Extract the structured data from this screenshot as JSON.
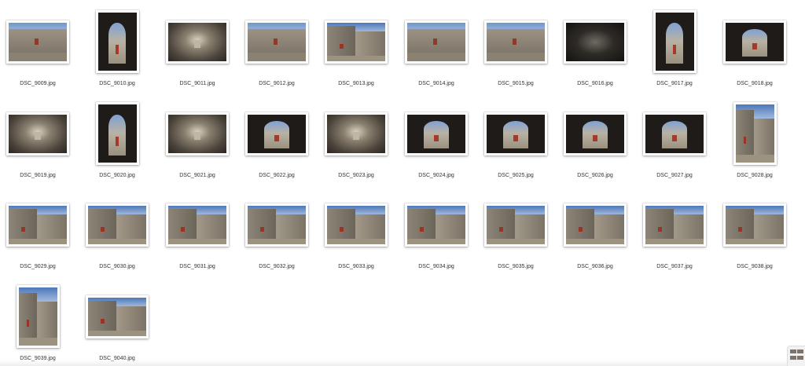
{
  "files": [
    {
      "name": "DSC_9009.jpg",
      "orientation": "landscape",
      "scene": "stone"
    },
    {
      "name": "DSC_9010.jpg",
      "orientation": "portrait",
      "scene": "arch"
    },
    {
      "name": "DSC_9011.jpg",
      "orientation": "landscape",
      "scene": "tunnel"
    },
    {
      "name": "DSC_9012.jpg",
      "orientation": "landscape",
      "scene": "stone"
    },
    {
      "name": "DSC_9013.jpg",
      "orientation": "landscape",
      "scene": "court"
    },
    {
      "name": "DSC_9014.jpg",
      "orientation": "landscape",
      "scene": "stone"
    },
    {
      "name": "DSC_9015.jpg",
      "orientation": "landscape",
      "scene": "stone"
    },
    {
      "name": "DSC_9016.jpg",
      "orientation": "landscape",
      "scene": "dark"
    },
    {
      "name": "DSC_9017.jpg",
      "orientation": "portrait",
      "scene": "arch"
    },
    {
      "name": "DSC_9018.jpg",
      "orientation": "landscape",
      "scene": "arch"
    },
    {
      "name": "DSC_9019.jpg",
      "orientation": "landscape",
      "scene": "tunnel"
    },
    {
      "name": "DSC_9020.jpg",
      "orientation": "portrait",
      "scene": "arch"
    },
    {
      "name": "DSC_9021.jpg",
      "orientation": "landscape",
      "scene": "tunnel"
    },
    {
      "name": "DSC_9022.jpg",
      "orientation": "landscape",
      "scene": "arch"
    },
    {
      "name": "DSC_9023.jpg",
      "orientation": "landscape",
      "scene": "tunnel"
    },
    {
      "name": "DSC_9024.jpg",
      "orientation": "landscape",
      "scene": "arch"
    },
    {
      "name": "DSC_9025.jpg",
      "orientation": "landscape",
      "scene": "arch"
    },
    {
      "name": "DSC_9026.jpg",
      "orientation": "landscape",
      "scene": "arch"
    },
    {
      "name": "DSC_9027.jpg",
      "orientation": "landscape",
      "scene": "arch"
    },
    {
      "name": "DSC_9028.jpg",
      "orientation": "portrait",
      "scene": "court"
    },
    {
      "name": "DSC_9029.jpg",
      "orientation": "landscape",
      "scene": "court"
    },
    {
      "name": "DSC_9030.jpg",
      "orientation": "landscape",
      "scene": "court"
    },
    {
      "name": "DSC_9031.jpg",
      "orientation": "landscape",
      "scene": "court"
    },
    {
      "name": "DSC_9032.jpg",
      "orientation": "landscape",
      "scene": "court"
    },
    {
      "name": "DSC_9033.jpg",
      "orientation": "landscape",
      "scene": "court"
    },
    {
      "name": "DSC_9034.jpg",
      "orientation": "landscape",
      "scene": "court"
    },
    {
      "name": "DSC_9035.jpg",
      "orientation": "landscape",
      "scene": "court"
    },
    {
      "name": "DSC_9036.jpg",
      "orientation": "landscape",
      "scene": "court"
    },
    {
      "name": "DSC_9037.jpg",
      "orientation": "landscape",
      "scene": "court"
    },
    {
      "name": "DSC_9038.jpg",
      "orientation": "landscape",
      "scene": "court"
    },
    {
      "name": "DSC_9039.jpg",
      "orientation": "portrait",
      "scene": "court"
    },
    {
      "name": "DSC_9040.jpg",
      "orientation": "landscape",
      "scene": "court"
    }
  ]
}
